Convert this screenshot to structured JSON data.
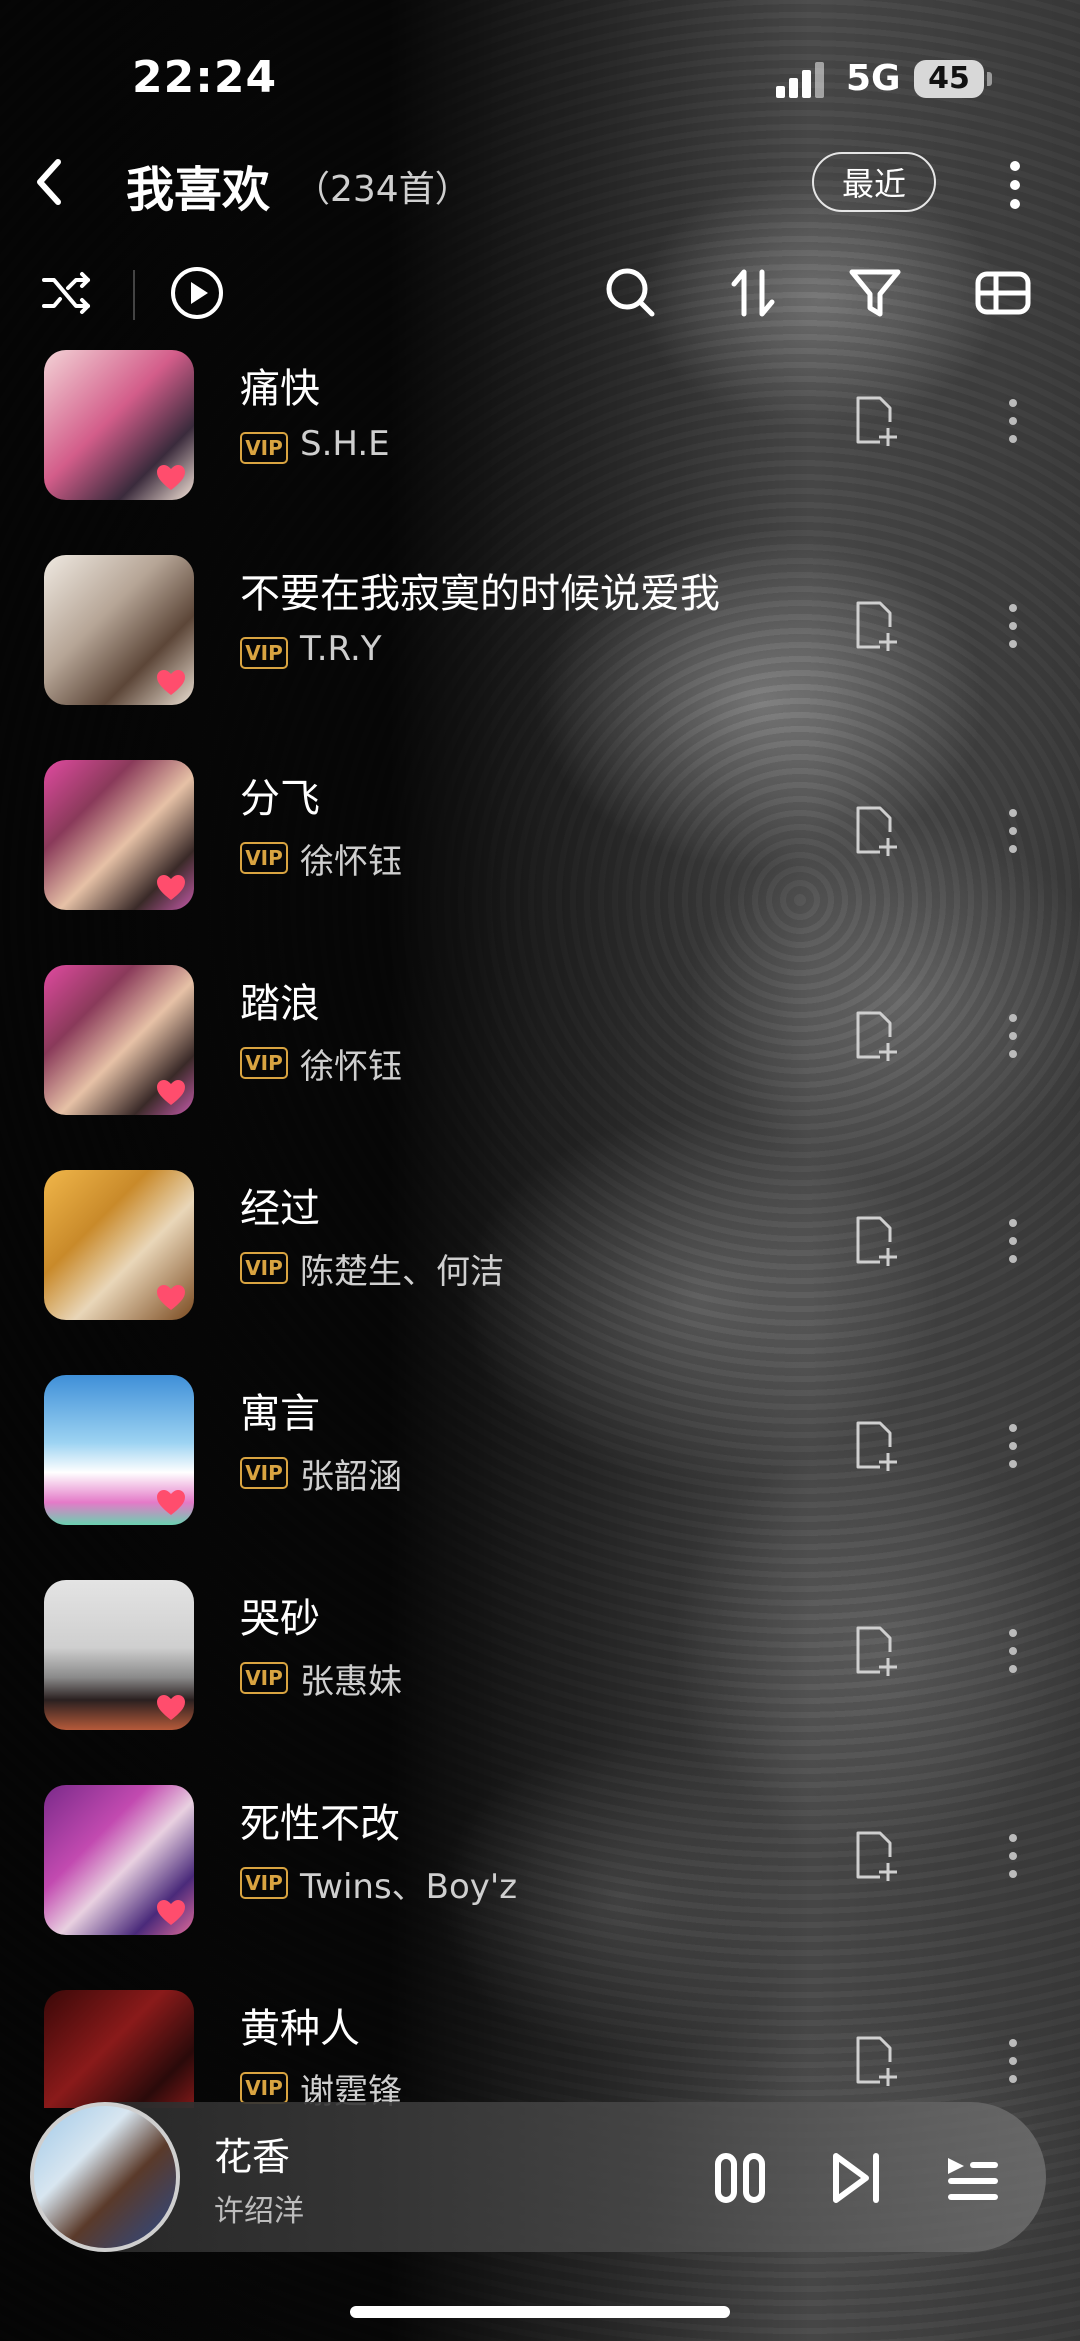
{
  "status": {
    "time": "22:24",
    "network": "5G",
    "battery": "45"
  },
  "header": {
    "title": "我喜欢",
    "count": "（234首）",
    "recent_label": "最近"
  },
  "vip_label": "VIP",
  "songs": [
    {
      "title": "痛快",
      "artist": "S.H.E"
    },
    {
      "title": "不要在我寂寞的时候说爱我",
      "artist": "T.R.Y"
    },
    {
      "title": "分飞",
      "artist": "徐怀钰"
    },
    {
      "title": "踏浪",
      "artist": "徐怀钰"
    },
    {
      "title": "经过",
      "artist": "陈楚生、何洁"
    },
    {
      "title": "寓言",
      "artist": "张韶涵"
    },
    {
      "title": "哭砂",
      "artist": "张惠妹"
    },
    {
      "title": "死性不改",
      "artist": "Twins、Boy'z"
    },
    {
      "title": "黄种人",
      "artist": "谢霆锋"
    }
  ],
  "player": {
    "song": "花香",
    "artist": "许绍洋"
  },
  "colors": {
    "vip": "#d9a441",
    "heart": "#ff4d6d",
    "text_secondary": "#cfcfcf"
  },
  "icons": [
    "back-icon",
    "more-icon",
    "shuffle-icon",
    "play-circle-icon",
    "search-icon",
    "sort-icon",
    "filter-icon",
    "layout-icon",
    "add-to-playlist-icon",
    "pause-icon",
    "next-icon",
    "playlist-icon",
    "heart-icon"
  ]
}
